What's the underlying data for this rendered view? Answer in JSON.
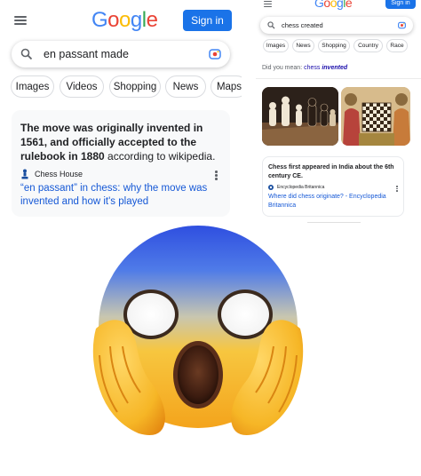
{
  "left": {
    "signin_label": "Sign in",
    "query": "en passant made",
    "tabs": [
      "Images",
      "Videos",
      "Shopping",
      "News",
      "Maps"
    ],
    "answer_bold_1": "The move was originally invented in 1561, and officially accepted to the rulebook in 1880",
    "answer_rest": " according to wikipedia.",
    "source_name": "Chess House",
    "result_link": "“en passant” in chess: why the move was invented and how it's played"
  },
  "right": {
    "signin_label": "Sign in",
    "query": "chess created",
    "tabs": [
      "Images",
      "News",
      "Shopping",
      "Country",
      "Race"
    ],
    "did_you_mean_prefix": "Did you mean: ",
    "did_you_mean_plain": "chess ",
    "did_you_mean_em": "invented",
    "answer": "Chess first appeared in India about the 6th century CE.",
    "source_name": "Encyclopedia Britannica",
    "result_link": "Where did chess originate? - Encyclopedia Britannica"
  },
  "logo_letters": [
    "G",
    "o",
    "o",
    "g",
    "l",
    "e"
  ],
  "colors": {
    "blue": "#4285f4",
    "red": "#ea4335",
    "yellow": "#fbbc05",
    "green": "#34a853",
    "signin": "#1a73e8",
    "link": "#1558d6"
  },
  "emoji": "face-screaming-in-fear"
}
